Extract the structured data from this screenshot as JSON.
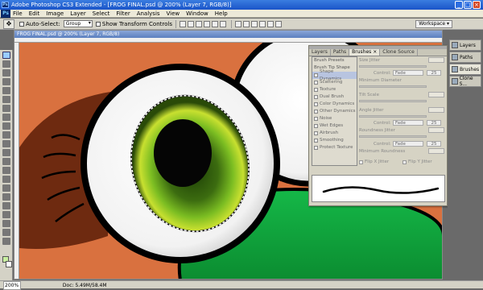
{
  "window": {
    "title": "Adobe Photoshop CS3 Extended - [FROG FINAL.psd @ 200% (Layer 7, RGB/8)]",
    "app_icon": "Ps"
  },
  "menu": [
    "File",
    "Edit",
    "Image",
    "Layer",
    "Select",
    "Filter",
    "Analysis",
    "View",
    "Window",
    "Help"
  ],
  "options_bar": {
    "auto_select_label": "Auto-Select:",
    "auto_select_value": "Group",
    "transform_label": "Show Transform Controls",
    "workspace_label": "Workspace ▾"
  },
  "document": {
    "title": "FROG FINAL.psd @ 200% (Layer 7, RGB/8)"
  },
  "status": {
    "zoom": "200%",
    "doc": "Doc: 5.49M/58.4M"
  },
  "brushes_panel": {
    "tabs": [
      "Layers",
      "Paths",
      "Brushes ×",
      "Clone Source"
    ],
    "left_items": [
      {
        "label": "Brush Presets",
        "type": "header"
      },
      {
        "label": "Brush Tip Shape",
        "type": "header"
      },
      {
        "label": "Shape Dynamics",
        "type": "check"
      },
      {
        "label": "Scattering",
        "type": "check"
      },
      {
        "label": "Texture",
        "type": "check"
      },
      {
        "label": "Dual Brush",
        "type": "check"
      },
      {
        "label": "Color Dynamics",
        "type": "check"
      },
      {
        "label": "Other Dynamics",
        "type": "check"
      },
      {
        "label": "Noise",
        "type": "check"
      },
      {
        "label": "Wet Edges",
        "type": "check"
      },
      {
        "label": "Airbrush",
        "type": "check"
      },
      {
        "label": "Smoothing",
        "type": "check"
      },
      {
        "label": "Protect Texture",
        "type": "check"
      }
    ],
    "size_jitter": "Size Jitter",
    "control": "Control:",
    "fade": "Fade",
    "control_value": "25",
    "minimum_diameter": "Minimum Diameter",
    "tilt_scale": "Tilt Scale",
    "angle_jitter": "Angle Jitter",
    "roundness_jitter": "Roundness Jitter",
    "minimum_roundness": "Minimum Roundness",
    "flip_x": "Flip X Jitter",
    "flip_y": "Flip Y Jitter"
  },
  "dock": [
    "Layers",
    "Paths",
    "Brushes",
    "Clone S..."
  ],
  "colors": {
    "bg_orange": "#d9713f",
    "hair": "#6e2a10",
    "frog_green": "#0faa3c",
    "iris": "#7ab820"
  }
}
